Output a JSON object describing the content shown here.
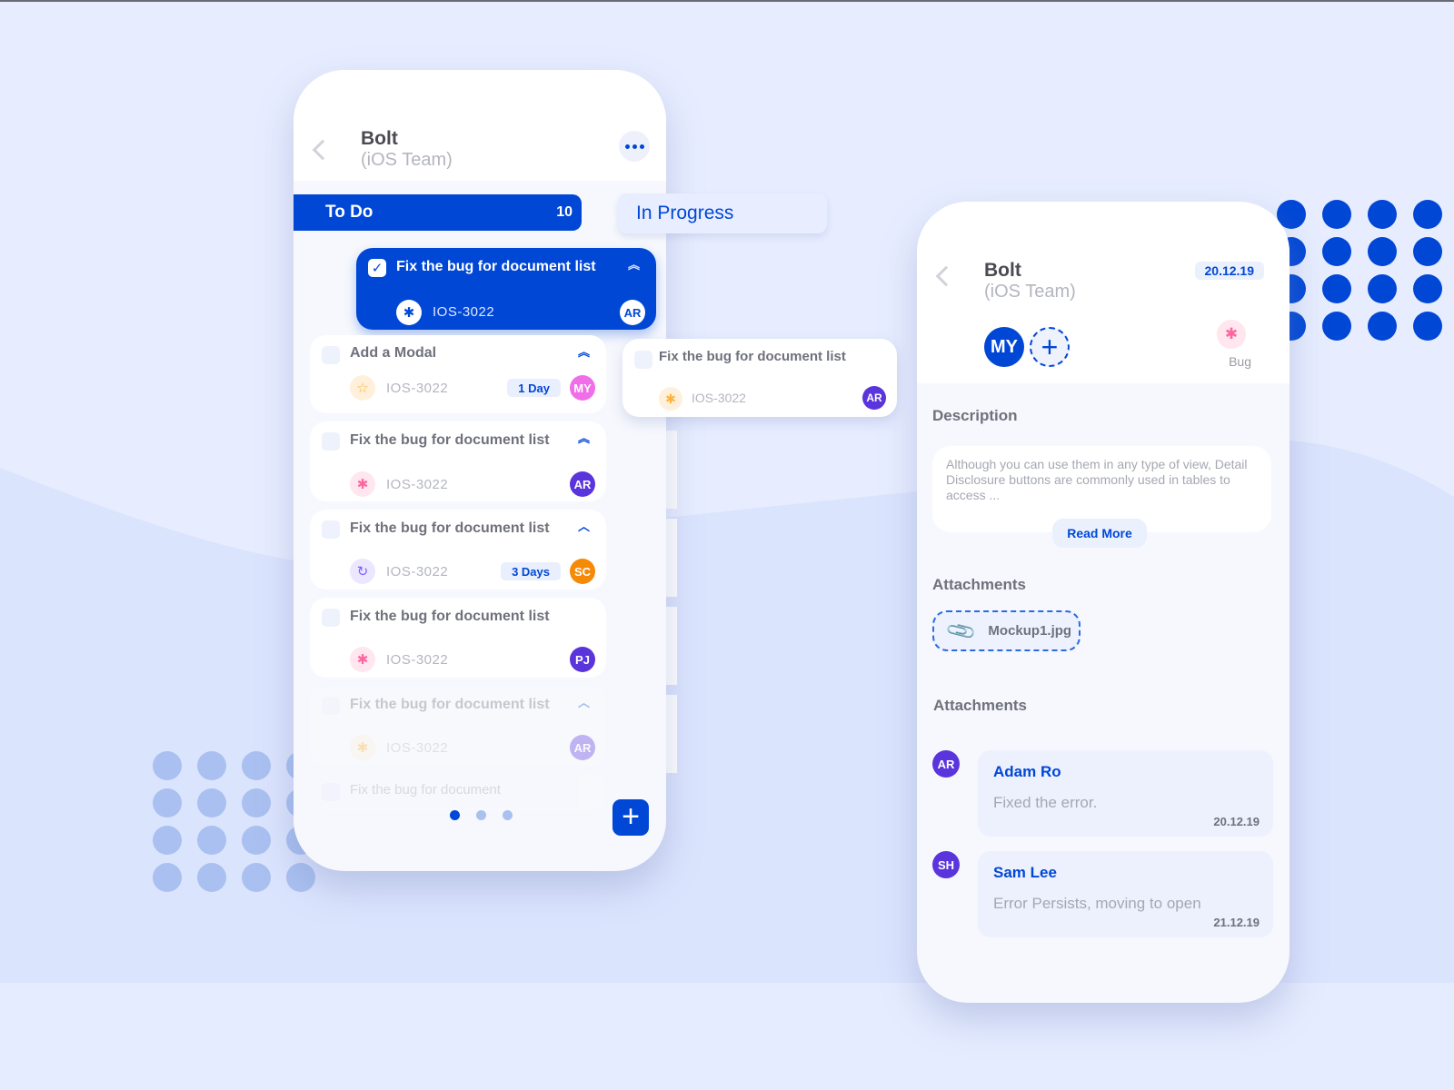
{
  "colors": {
    "primary": "#0047d6",
    "background": "#e7edff",
    "bug_pink": "#ff66a0",
    "star_orange": "#ffb13b",
    "refresh_purple": "#7b61ff",
    "avatar_purple": "#5b35dc",
    "avatar_pink": "#f06ee8",
    "avatar_orange": "#f58a07"
  },
  "board": {
    "project_title": "Bolt",
    "team": "(iOS Team)",
    "back_icon": "chevron-left-icon",
    "more_icon": "more-horizontal-icon",
    "columns": [
      {
        "label": "To Do",
        "count": "10",
        "active": true
      },
      {
        "label": "In Progress",
        "active": false
      }
    ],
    "todo_cards": [
      {
        "title": "Fix the bug for document list",
        "id": "IOS-3022",
        "type_icon": "bug-icon",
        "priority_icon": "double-chevron-up-icon",
        "assignee": "AR",
        "checked": true,
        "active": true
      },
      {
        "title": "Add a Modal",
        "id": "IOS-3022",
        "type_icon": "star-icon",
        "priority_icon": "double-chevron-up-icon",
        "badge": "1 Day",
        "assignee": "MY",
        "checked": false
      },
      {
        "title": "Fix the bug for document list",
        "id": "IOS-3022",
        "type_icon": "bug-icon",
        "priority_icon": "triple-chevron-up-icon",
        "assignee": "AR",
        "checked": false
      },
      {
        "title": "Fix the bug for document list",
        "id": "IOS-3022",
        "type_icon": "refresh-icon",
        "priority_icon": "chevron-up-icon",
        "badge": "3 Days",
        "assignee": "SC",
        "checked": false
      },
      {
        "title": "Fix the bug for document list",
        "id": "IOS-3022",
        "type_icon": "bug-icon",
        "assignee": "PJ",
        "checked": false
      },
      {
        "title": "Fix the bug for document list",
        "id": "IOS-3022",
        "type_icon": "bug-icon",
        "priority_icon": "chevron-up-icon",
        "assignee": "AR",
        "checked": false,
        "faded": true
      },
      {
        "title": "Fix the bug for document",
        "faded": true
      }
    ],
    "inprogress_card": {
      "title": "Fix the bug for document list",
      "id": "IOS-3022",
      "type_icon": "bug-icon",
      "assignee": "AR"
    },
    "pager": {
      "pages": 3,
      "current": 1
    },
    "fab_label": "+"
  },
  "detail": {
    "project_title": "Bolt",
    "team": "(iOS Team)",
    "date": "20.12.19",
    "member": "MY",
    "add_member_label": "+",
    "type_label": "Bug",
    "description_heading": "Description",
    "description": "Although you can use them in any type of view, Detail Disclosure buttons are commonly used in tables to access ...",
    "read_more": "Read More",
    "attachments_heading": "Attachments",
    "attachment_file": "Mockup1.jpg",
    "comments_heading": "Attachments",
    "comments": [
      {
        "initials": "AR",
        "author": "Adam Ro",
        "text": "Fixed the error.",
        "date": "20.12.19"
      },
      {
        "initials": "SH",
        "author": "Sam Lee",
        "text": "Error Persists, moving to open",
        "date": "21.12.19"
      }
    ]
  }
}
